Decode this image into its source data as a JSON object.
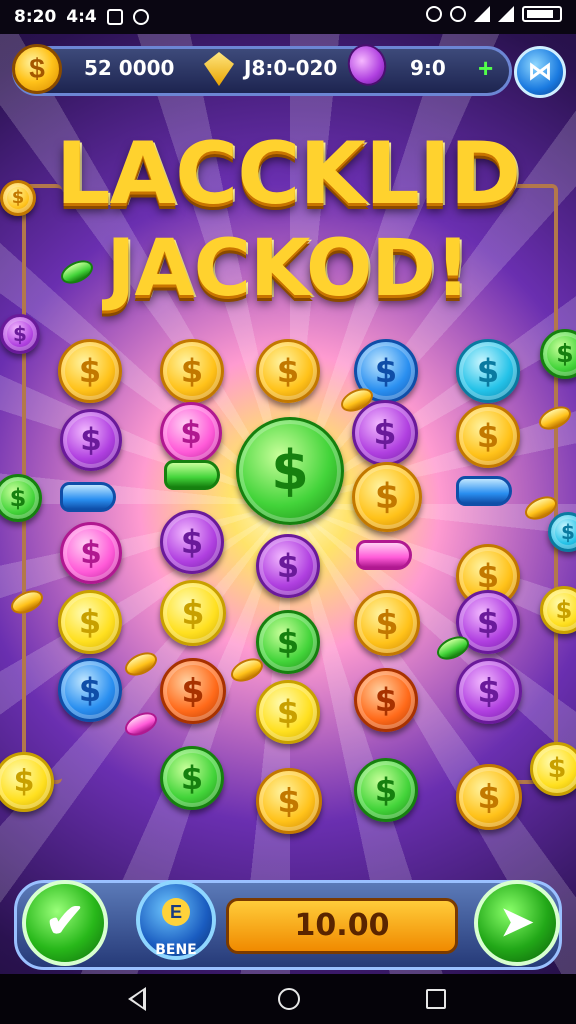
{
  "status_bar": {
    "time": "8:20",
    "left_text": "4:4"
  },
  "top_bar": {
    "coin_balance": "52 0000",
    "gem_balance": "J8:0-020",
    "tokens": "9:0",
    "coin_symbol": "$"
  },
  "title": {
    "line1": "LACCKLID",
    "line2": "JACKOD!"
  },
  "coin_symbol": "$",
  "colors": {
    "gold": "#ffc21a",
    "pink": "#ff5bd8",
    "purple": "#b040e0",
    "green": "#43d43a",
    "blue": "#2a8ff0",
    "cyan": "#24c2e8",
    "orange": "#ff6a1a",
    "yellow": "#ffe020"
  },
  "bottom_bar": {
    "bonus_label": "BENE",
    "bet_amount": "10.00",
    "bonus_icon_letter": "E"
  }
}
